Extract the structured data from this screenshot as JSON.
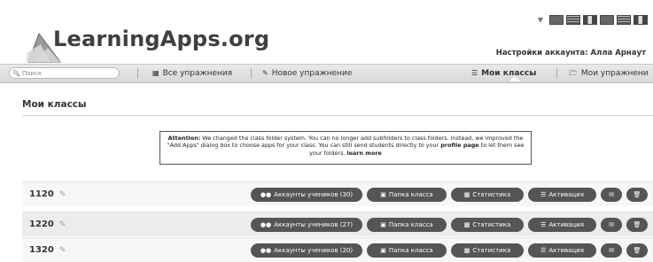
{
  "header": {
    "logo_text": "LearningApps.org",
    "account_label": "Настройки аккаунта: Алла Арнаут"
  },
  "nav": {
    "search_placeholder": "Поиск",
    "all_exercises": "Все упражнения",
    "new_exercise": "Новое упражнение",
    "my_classes": "Мои классы",
    "my_exercises": "Мои упражнени"
  },
  "main": {
    "section_title": "Мои классы",
    "notice": {
      "strong": "Attention:",
      "text": "We changed the class folder system. You can no longer add subfolders to class folders. Instead, we improved the \"Add Apps\" dialog box to choose apps for your class. You can still send students directly to your",
      "link1": "profile page",
      "text2": "to let them see your folders.",
      "link2": "learn more"
    }
  },
  "classes": [
    {
      "name": "1120",
      "accounts_label": "Аккаунты учеников (30)"
    },
    {
      "name": "1220",
      "accounts_label": "Аккаунты учеников (27)"
    },
    {
      "name": "1320",
      "accounts_label": "Аккаунты учеников (20)"
    }
  ],
  "row_buttons": {
    "folder": "Папка класса",
    "stats": "Статистика",
    "activation": "Активация"
  },
  "icons": {
    "search": "search-icon",
    "grid": "grid-icon",
    "pencil": "pencil-icon",
    "list": "list-icon",
    "folder": "folder-icon",
    "users": "users-icon",
    "chart": "chart-icon",
    "mail": "mail-icon",
    "trash": "trash-icon"
  }
}
